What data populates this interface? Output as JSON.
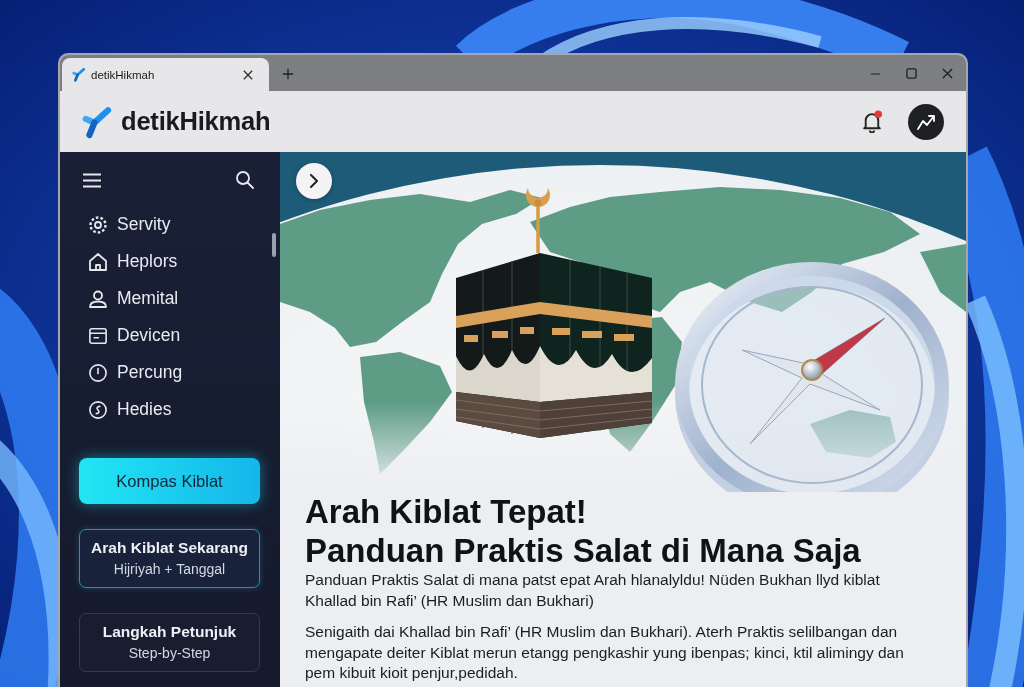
{
  "browser": {
    "tabs": [
      {
        "title": "detikHikmah",
        "selected": true
      }
    ]
  },
  "header": {
    "site_name": "detikHikmah",
    "notifications_unread": true
  },
  "sidebar": {
    "menu": [
      {
        "label": "Servity"
      },
      {
        "label": "Heplors"
      },
      {
        "label": "Memital"
      },
      {
        "label": "Devicen"
      },
      {
        "label": "Percung"
      },
      {
        "label": "Hedies"
      }
    ],
    "primary_button": {
      "label": "Kompas Kiblat"
    },
    "cards": [
      {
        "title": "Arah Kiblat Sekarang",
        "subtitle": "Hijriyah + Tanggal",
        "selected": true
      },
      {
        "title": "Langkah Petunjuk",
        "subtitle": "Step-by-Step",
        "selected": false
      }
    ]
  },
  "article": {
    "title_lines": [
      "Arah Kiblat Tepat!",
      "Panduan Praktis Salat di Mana Saja"
    ],
    "paragraphs": [
      "Panduan Praktis Salat di mana patst epat Arah hlanalyldu! Nüden Bukhan llyd kiblat Khallad bin Rafi’ (HR Muslim dan Bukhari)",
      "Senigaith dai Khallad bin Rafi’ (HR Muslim dan Bukhari). Aterh Praktis selilbangan dan mengapate deiter Kiblat merun etangg pengkashir yung ibenpas; kinci, ktil alimingy dan pem kibuit kioit penjur,pedidah."
    ]
  }
}
